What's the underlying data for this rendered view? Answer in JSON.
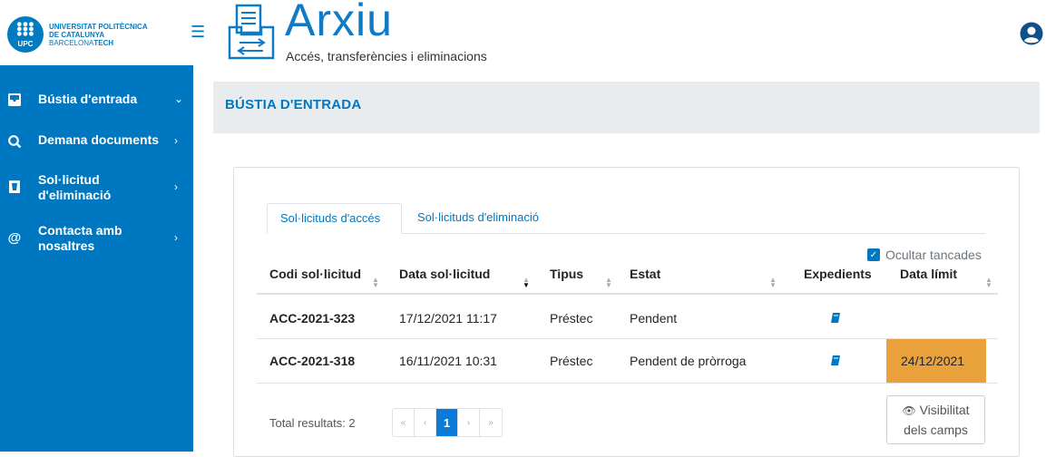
{
  "brand": {
    "line1": "UNIVERSITAT POLITÈCNICA",
    "line2": "DE CATALUNYA",
    "line3_a": "BARCELONA",
    "line3_b": "TECH",
    "mark": "UPC"
  },
  "app": {
    "title": "Arxiu",
    "subtitle": "Accés, transferències i eliminacions"
  },
  "sidebar": {
    "items": [
      {
        "label": "Bústia d'entrada",
        "icon": "inbox-icon",
        "chevron": "⌄"
      },
      {
        "label": "Demana documents",
        "icon": "search-icon",
        "chevron": "›"
      },
      {
        "label": "Sol·licitud d'eliminació",
        "icon": "trash-icon",
        "chevron": "›"
      },
      {
        "label": "Contacta amb nosaltres",
        "icon": "at-icon",
        "chevron": "›"
      }
    ]
  },
  "page": {
    "title": "BÚSTIA D'ENTRADA"
  },
  "tabs": [
    {
      "label": "Sol·licituds d'accés",
      "active": true
    },
    {
      "label": "Sol·licituds d'eliminació",
      "active": false
    }
  ],
  "filter": {
    "hide_closed_label": "Ocultar tancades",
    "hide_closed_checked": true
  },
  "table": {
    "headers": [
      "Codi sol·licitud",
      "Data sol·licitud",
      "Tipus",
      "Estat",
      "Expedients",
      "Data límit"
    ],
    "rows": [
      {
        "code": "ACC-2021-323",
        "date": "17/12/2021 11:17",
        "type": "Préstec",
        "status": "Pendent",
        "deadline": ""
      },
      {
        "code": "ACC-2021-318",
        "date": "16/11/2021 10:31",
        "type": "Préstec",
        "status": "Pendent de pròrroga",
        "deadline": "24/12/2021"
      }
    ]
  },
  "footer": {
    "total_label": "Total resultats: 2",
    "pager": [
      "«",
      "‹",
      "1",
      "›",
      "»"
    ],
    "current_page": "1",
    "visibility_line1": "Visibilitat",
    "visibility_line2": "dels camps"
  },
  "colors": {
    "primary": "#0078c1",
    "deadline_highlight": "#e9a23b",
    "header_band": "#e9ecef"
  }
}
